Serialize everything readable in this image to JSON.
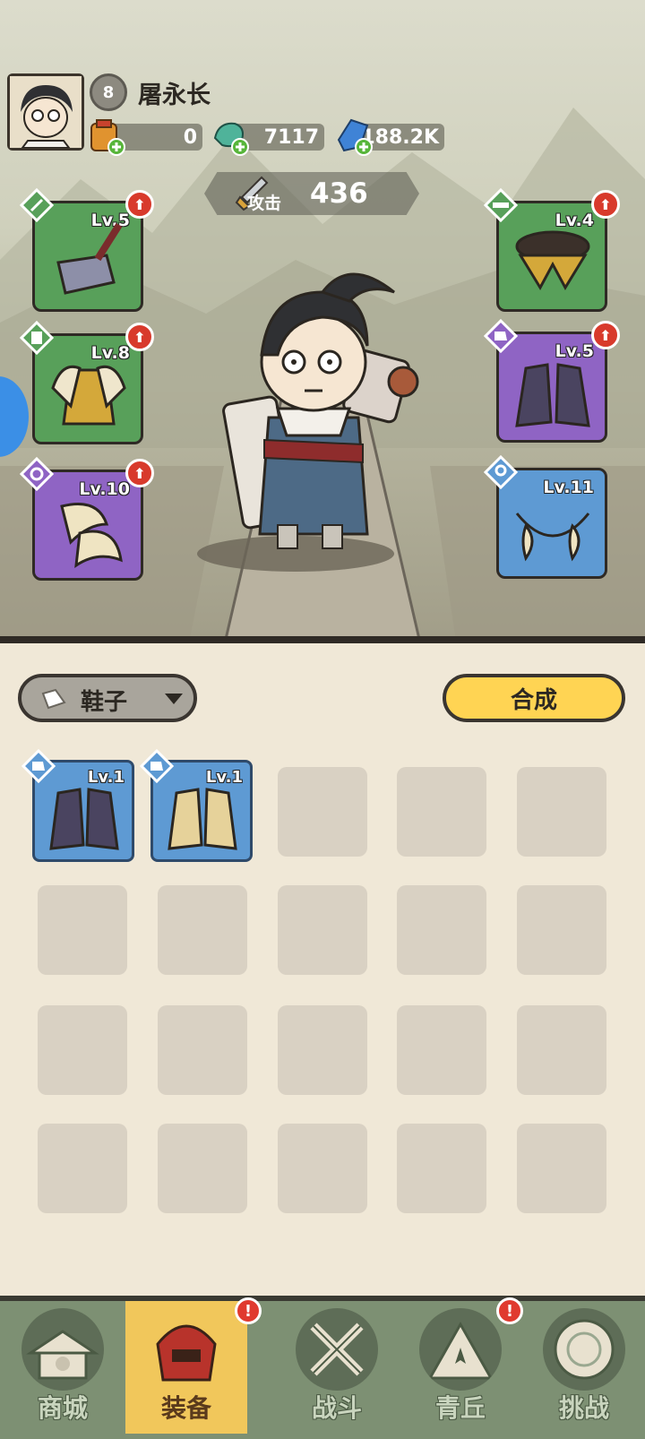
{
  "player": {
    "name": "屠永长",
    "level": "8",
    "avatar_icon": "hero-portrait-icon"
  },
  "resources": [
    {
      "name": "scroll-ticket",
      "value": "0",
      "icon": "scroll-bag-icon"
    },
    {
      "name": "jade-dragon",
      "value": "7117",
      "icon": "dragon-coin-icon"
    },
    {
      "name": "crystal",
      "value": "188.2K",
      "icon": "crystal-icon"
    }
  ],
  "attack": {
    "label": "攻击",
    "value": "436"
  },
  "equipment_slots": {
    "left": [
      {
        "slot": "weapon",
        "level": "Lv.5",
        "rarity": "green",
        "upgrade": true
      },
      {
        "slot": "armor",
        "level": "Lv.8",
        "rarity": "green",
        "upgrade": true
      },
      {
        "slot": "bracer",
        "level": "Lv.10",
        "rarity": "purple",
        "upgrade": true
      }
    ],
    "right": [
      {
        "slot": "belt",
        "level": "Lv.4",
        "rarity": "green",
        "upgrade": true
      },
      {
        "slot": "boots",
        "level": "Lv.5",
        "rarity": "purple",
        "upgrade": true
      },
      {
        "slot": "necklace",
        "level": "Lv.11",
        "rarity": "blue",
        "upgrade": false
      }
    ]
  },
  "inventory": {
    "filter_label": "鞋子",
    "combine_label": "合成",
    "items": [
      {
        "level": "Lv.1",
        "kind": "dark-boots"
      },
      {
        "level": "Lv.1",
        "kind": "gold-boots"
      }
    ],
    "grid_rows": 4,
    "grid_cols": 5
  },
  "nav": {
    "tabs": [
      {
        "label": "商城",
        "icon": "shop-icon",
        "active": false,
        "alert": false
      },
      {
        "label": "装备",
        "icon": "helmet-icon",
        "active": true,
        "alert": true
      },
      {
        "label": "战斗",
        "icon": "crossed-swords-icon",
        "active": false,
        "alert": false
      },
      {
        "label": "青丘",
        "icon": "mountain-icon",
        "active": false,
        "alert": true
      },
      {
        "label": "挑战",
        "icon": "challenge-gong-icon",
        "active": false,
        "alert": false
      }
    ],
    "alert_mark": "!"
  },
  "colors": {
    "green_rarity": "#58a05a",
    "purple_rarity": "#8f64c4",
    "blue_rarity": "#5e9ad3",
    "combine_button": "#ffd453",
    "active_tab": "#f1c75b",
    "upgrade_badge": "#d83a2c"
  },
  "upgrade_mark": "⬆"
}
